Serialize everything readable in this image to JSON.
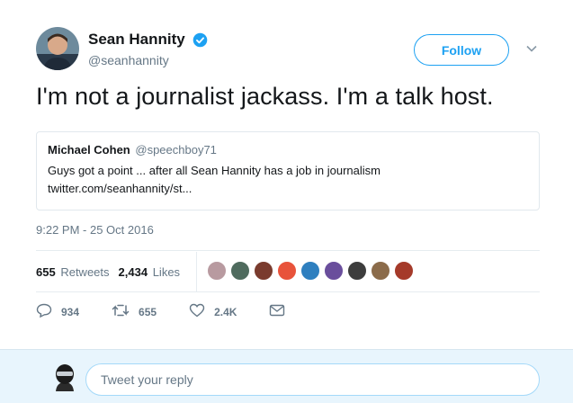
{
  "author": {
    "name": "Sean Hannity",
    "handle": "@seanhannity"
  },
  "follow_label": "Follow",
  "tweet_text": "I'm not a journalist jackass. I'm a talk host.",
  "quote": {
    "name": "Michael Cohen",
    "handle": "@speechboy71",
    "line1": "Guys got a point ... after all Sean Hannity has a job in journalism",
    "line2": "twitter.com/seanhannity/st..."
  },
  "timestamp": "9:22 PM - 25 Oct 2016",
  "stats": {
    "retweets_count": "655",
    "retweets_label": "Retweets",
    "likes_count": "2,434",
    "likes_label": "Likes"
  },
  "liker_colors": [
    "#b89aa0",
    "#4f6b5e",
    "#7a3b2e",
    "#e8533b",
    "#2e7fbf",
    "#6a4e9c",
    "#3d3d3d",
    "#8b6b4a",
    "#a53a2a"
  ],
  "actions": {
    "replies": "934",
    "retweets": "655",
    "likes": "2.4K"
  },
  "reply": {
    "placeholder": "Tweet your reply"
  },
  "colors": {
    "accent": "#1da1f2",
    "muted": "#657786",
    "reply_bg": "#e8f5fd"
  }
}
